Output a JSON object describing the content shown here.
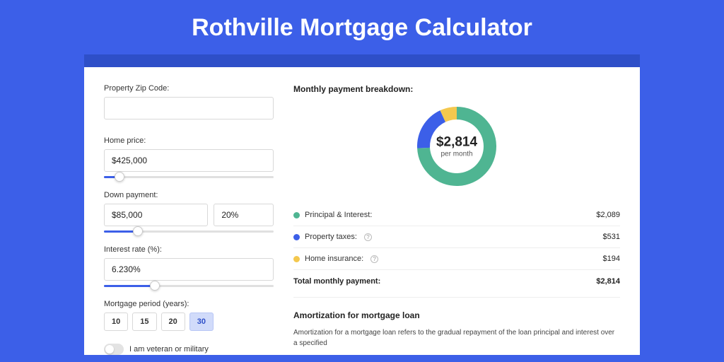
{
  "title": "Rothville Mortgage Calculator",
  "form": {
    "zip_label": "Property Zip Code:",
    "zip_value": "",
    "home_price_label": "Home price:",
    "home_price_value": "$425,000",
    "home_price_slider_pct": 9,
    "down_payment_label": "Down payment:",
    "down_payment_value": "$85,000",
    "down_payment_pct_value": "20%",
    "down_payment_slider_pct": 20,
    "interest_label": "Interest rate (%):",
    "interest_value": "6.230%",
    "interest_slider_pct": 30,
    "period_label": "Mortgage period (years):",
    "periods": [
      "10",
      "15",
      "20",
      "30"
    ],
    "period_active_index": 3,
    "veteran_label": "I am veteran or military"
  },
  "breakdown": {
    "title": "Monthly payment breakdown:",
    "center_amount": "$2,814",
    "center_sub": "per month",
    "items": [
      {
        "label": "Principal & Interest:",
        "value": "$2,089",
        "color": "#4FB592",
        "info": false
      },
      {
        "label": "Property taxes:",
        "value": "$531",
        "color": "#3C5FE8",
        "info": true
      },
      {
        "label": "Home insurance:",
        "value": "$194",
        "color": "#F4C84E",
        "info": true
      }
    ],
    "total_label": "Total monthly payment:",
    "total_value": "$2,814"
  },
  "amort": {
    "title": "Amortization for mortgage loan",
    "text": "Amortization for a mortgage loan refers to the gradual repayment of the loan principal and interest over a specified"
  },
  "chart_data": {
    "type": "pie",
    "title": "Monthly payment breakdown",
    "series": [
      {
        "name": "Principal & Interest",
        "value": 2089,
        "color": "#4FB592"
      },
      {
        "name": "Property taxes",
        "value": 531,
        "color": "#3C5FE8"
      },
      {
        "name": "Home insurance",
        "value": 194,
        "color": "#F4C84E"
      }
    ],
    "total": 2814,
    "donut": true
  }
}
